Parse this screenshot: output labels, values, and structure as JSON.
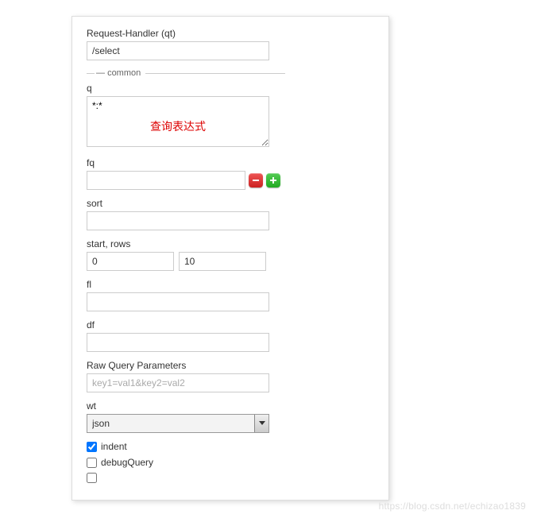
{
  "form": {
    "qt_label": "Request-Handler (qt)",
    "qt_value": "/select",
    "fieldset_legend": "common",
    "q_label": "q",
    "q_value": "*:*",
    "q_annotation": "查询表达式",
    "fq_label": "fq",
    "fq_value": "",
    "sort_label": "sort",
    "sort_value": "",
    "startrows_label": "start, rows",
    "start_value": "0",
    "rows_value": "10",
    "fl_label": "fl",
    "fl_value": "",
    "df_label": "df",
    "df_value": "",
    "raw_label": "Raw Query Parameters",
    "raw_placeholder": "key1=val1&key2=val2",
    "raw_value": "",
    "wt_label": "wt",
    "wt_value": "json",
    "indent_label": "indent",
    "indent_checked": true,
    "debug_label": "debugQuery",
    "debug_checked": false
  },
  "watermark": "https://blog.csdn.net/echizao1839"
}
